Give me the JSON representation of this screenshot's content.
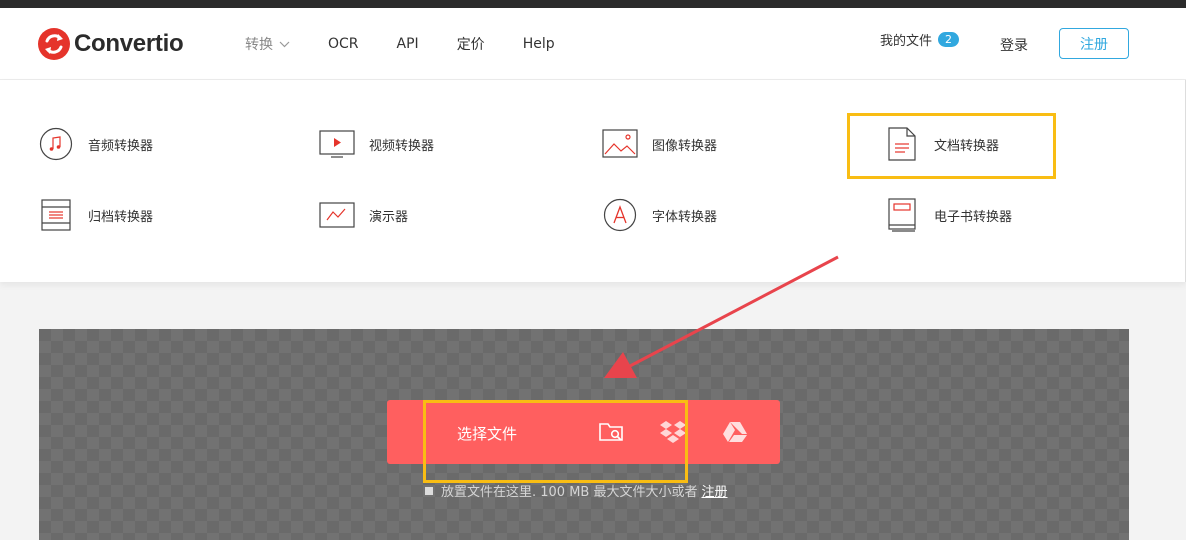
{
  "header": {
    "brand": "Convertio",
    "nav": {
      "convert": "转换",
      "ocr": "OCR",
      "api": "API",
      "pricing": "定价",
      "help": "Help"
    },
    "my_files": "我的文件",
    "my_files_count": "2",
    "login": "登录",
    "signup": "注册"
  },
  "dropdown": {
    "audio": "音频转换器",
    "video": "视频转换器",
    "image": "图像转换器",
    "document": "文档转换器",
    "archive": "归档转换器",
    "presentation": "演示器",
    "font": "字体转换器",
    "ebook": "电子书转换器"
  },
  "upload": {
    "choose_files": "选择文件",
    "hint_text": "放置文件在这里. 100 MB 最大文件大小或者",
    "hint_link": "注册"
  },
  "colors": {
    "brand_red": "#e5342b",
    "upload_red": "#ff5f5f",
    "accent_blue": "#31a8df",
    "highlight_yellow": "#f9bd13",
    "arrow_red": "#e8444c"
  },
  "icons": {
    "source_folder": "folder-search-icon",
    "source_dropbox": "dropbox-icon",
    "source_drive": "google-drive-icon"
  }
}
